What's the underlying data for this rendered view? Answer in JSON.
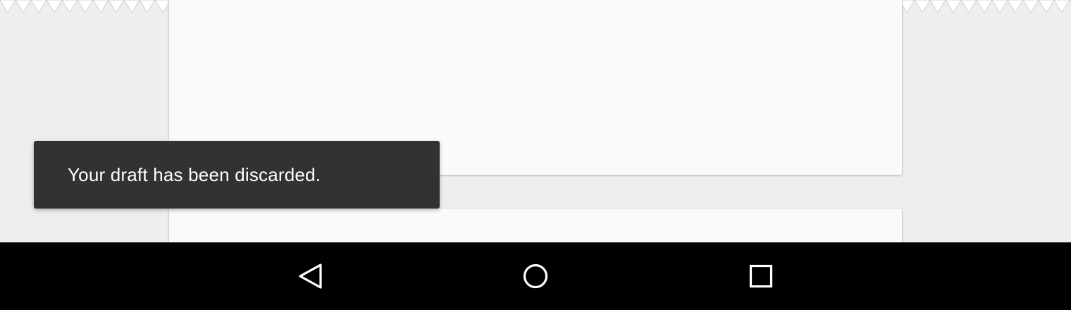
{
  "snackbar": {
    "message": "Your draft has been discarded."
  },
  "colors": {
    "background": "#eeeeee",
    "card": "#fafafa",
    "snackbar_bg": "#323232",
    "snackbar_text": "#ffffff",
    "nav_bar": "#000000",
    "nav_icon": "#ffffff"
  },
  "navigation_bar": {
    "buttons": [
      {
        "name": "back",
        "icon": "back-triangle-icon"
      },
      {
        "name": "home",
        "icon": "home-circle-icon"
      },
      {
        "name": "recents",
        "icon": "recents-square-icon"
      }
    ]
  }
}
